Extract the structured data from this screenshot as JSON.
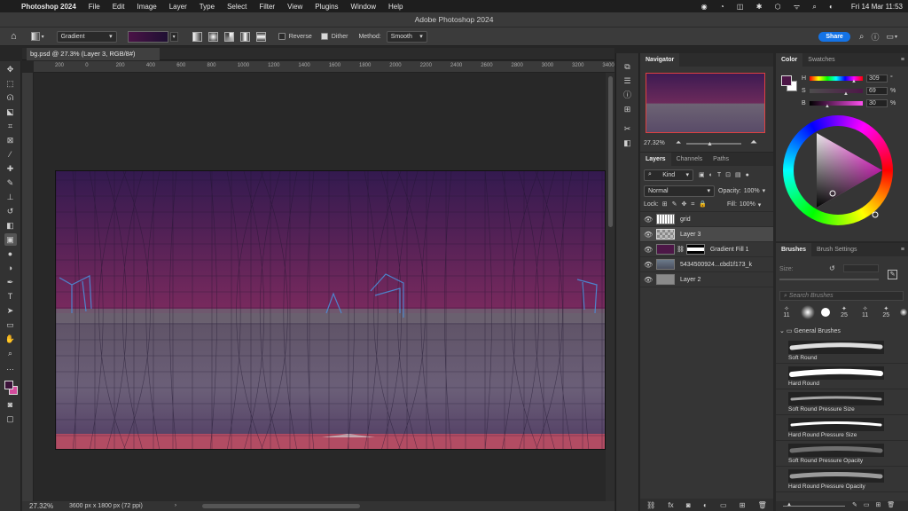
{
  "menubar": {
    "app": "Photoshop 2024",
    "items": [
      "File",
      "Edit",
      "Image",
      "Layer",
      "Type",
      "Select",
      "Filter",
      "View",
      "Plugins",
      "Window",
      "Help"
    ],
    "clock": "Fri 14 Mar  11:53"
  },
  "window": {
    "title": "Adobe Photoshop 2024"
  },
  "options": {
    "tool": "Gradient",
    "reverse": "Reverse",
    "dither": "Dither",
    "method_label": "Method:",
    "method": "Smooth",
    "share": "Share"
  },
  "document": {
    "tab": "bg.psd @ 27.3% (Layer 3, RGB/8#)",
    "zoom": "27.32%",
    "size": "3600 px x 1800 px (72 ppi)",
    "ruler": [
      "200",
      "0",
      "200",
      "400",
      "600",
      "800",
      "1000",
      "1200",
      "1400",
      "1600",
      "1800",
      "2000",
      "2200",
      "2400",
      "2600",
      "2800",
      "3000",
      "3200",
      "3400"
    ]
  },
  "navigator": {
    "title": "Navigator",
    "zoom": "27.32%"
  },
  "layers": {
    "tabs": [
      "Layers",
      "Channels",
      "Paths"
    ],
    "kind": "Kind",
    "blend": "Normal",
    "opacity_label": "Opacity:",
    "opacity": "100%",
    "lock_label": "Lock:",
    "fill_label": "Fill:",
    "fill": "100%",
    "items": [
      {
        "name": "grid"
      },
      {
        "name": "Layer 3"
      },
      {
        "name": "Gradient Fill 1"
      },
      {
        "name": "5434500924...cbd1f173_k"
      },
      {
        "name": "Layer 2"
      }
    ]
  },
  "color": {
    "tabs": [
      "Color",
      "Swatches"
    ],
    "h_label": "H",
    "h": "309",
    "s_label": "S",
    "s": "69",
    "b_label": "B",
    "b": "30",
    "deg": "°",
    "pct": "%",
    "fg": "#4d1747",
    "bg": "#ffffff"
  },
  "brushes": {
    "tabs": [
      "Brushes",
      "Brush Settings"
    ],
    "size_label": "Size:",
    "search": "Search Brushes",
    "group": "General Brushes",
    "presets": [
      "11",
      "",
      "",
      "",
      "25",
      "11",
      "25",
      ""
    ],
    "items": [
      "Soft Round",
      "Hard Round",
      "Soft Round Pressure Size",
      "Hard Round Pressure Size",
      "Soft Round Pressure Opacity",
      "Hard Round Pressure Opacity"
    ]
  }
}
